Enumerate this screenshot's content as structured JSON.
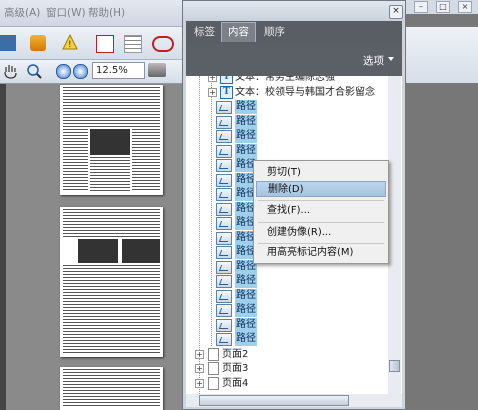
{
  "menubar": {
    "items": [
      "高级(A)",
      "窗口(W)",
      "帮助(H)"
    ]
  },
  "toolbar": {
    "zoom_value": "12.5%"
  },
  "panel": {
    "close_glyph": "×",
    "tabs": [
      "标签",
      "内容",
      "顺序"
    ],
    "active_tab": "内容",
    "options_label": "选项",
    "tree": {
      "text_items": [
        "文本：常务主编陈志强",
        "文本：校领导与韩国才合影留念"
      ],
      "path_label": "路径",
      "path_count": 17,
      "selected_path_index": 6,
      "pages": [
        "页面2",
        "页面3",
        "页面4"
      ]
    }
  },
  "context_menu": {
    "items": [
      {
        "label": "剪切(T)",
        "selected": false
      },
      {
        "label": "删除(D)",
        "selected": true
      },
      {
        "label": "查找(F)...",
        "selected": false
      },
      {
        "label": "创建伪像(R)...",
        "selected": false
      },
      {
        "label": "用高亮标记内容(M)",
        "selected": false
      }
    ]
  },
  "window_controls": [
    "–",
    "□",
    "×"
  ],
  "colors": {
    "highlight": "#9ed0ec",
    "menu_selected": "#a6c4de",
    "panel_dark": "#595d64"
  }
}
